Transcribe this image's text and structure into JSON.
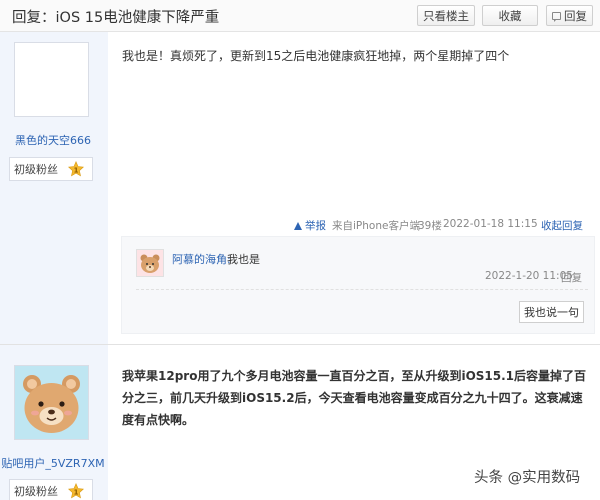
{
  "header": {
    "title": "回复：iOS 15电池健康下降严重",
    "only_op_label": "只看楼主",
    "favorite_label": "收藏",
    "reply_label": "回复"
  },
  "posts": [
    {
      "author": {
        "name": "黑色的天空666",
        "level": "初级粉丝"
      },
      "content": "我也是！真烦死了，更新到15之后电池健康疯狂地掉，两个星期掉了四个",
      "meta": {
        "report_label": "举报",
        "client": "来自iPhone客户端",
        "floor": "39楼",
        "time": "2022-01-18 11:15",
        "collapse_label": "收起回复"
      },
      "sub_replies": [
        {
          "user": "阿慕的海角:",
          "text": "我也是",
          "time": "2022-1-20 11:05",
          "reply_label": "回复"
        }
      ],
      "say_button": "我也说一句"
    },
    {
      "author": {
        "name": "贴吧用户_5VZR7XM",
        "level": "初级粉丝"
      },
      "content": "我苹果12pro用了九个多月电池容量一直百分之百，至从升级到iOS15.1后容量掉了百分之三，前几天升级到iOS15.2后，今天查看电池容量变成百分之九十四了。这衰减速度有点快啊。"
    }
  ],
  "watermark": "头条 @实用数码",
  "colors": {
    "link": "#2d64b3",
    "sidebar_bg": "#f1f5fc",
    "star": "#f5b92e"
  }
}
